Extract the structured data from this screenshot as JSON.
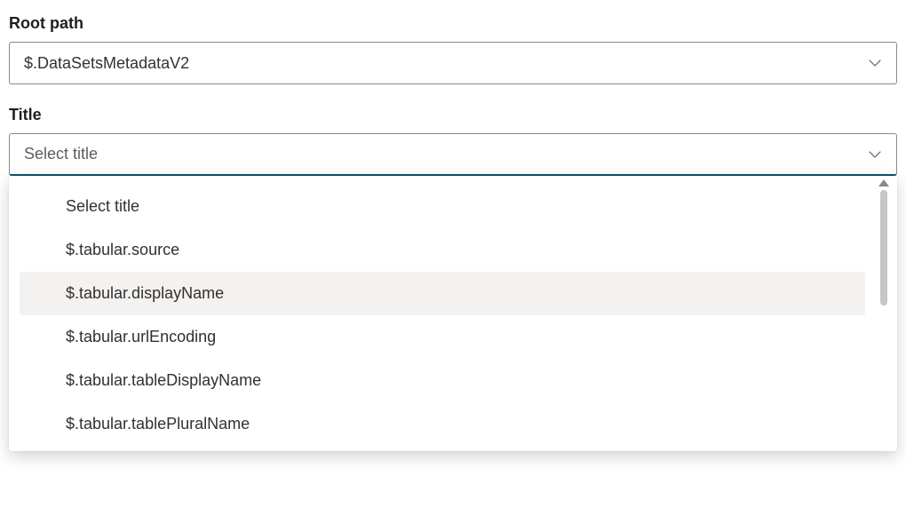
{
  "root_path": {
    "label": "Root path",
    "value": "$.DataSetsMetadataV2"
  },
  "title": {
    "label": "Title",
    "placeholder": "Select title",
    "options": [
      {
        "label": "Select title",
        "highlighted": false
      },
      {
        "label": "$.tabular.source",
        "highlighted": false
      },
      {
        "label": "$.tabular.displayName",
        "highlighted": true
      },
      {
        "label": "$.tabular.urlEncoding",
        "highlighted": false
      },
      {
        "label": "$.tabular.tableDisplayName",
        "highlighted": false
      },
      {
        "label": "$.tabular.tablePluralName",
        "highlighted": false
      }
    ]
  }
}
